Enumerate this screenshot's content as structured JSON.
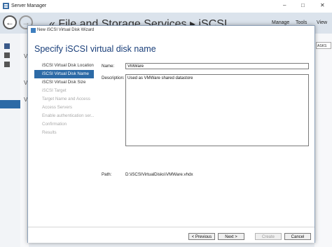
{
  "server_manager": {
    "title": "Server Manager",
    "breadcrumb": "« File and Storage Services ▸ iSCSI",
    "menu": [
      "Manage",
      "Tools",
      "View"
    ],
    "tasks_label": "ASKS",
    "minimize": "–",
    "maximize": "□",
    "close": "✕",
    "back": "←",
    "forward": "→",
    "left_letters": [
      "V",
      "V",
      "V"
    ]
  },
  "wizard": {
    "title": "New iSCSI Virtual Disk Wizard",
    "heading": "Specify iSCSI virtual disk name",
    "steps": [
      {
        "label": "iSCSI Virtual Disk Location",
        "state": "done"
      },
      {
        "label": "iSCSI Virtual Disk Name",
        "state": "active"
      },
      {
        "label": "iSCSI Virtual Disk Size",
        "state": "enabled"
      },
      {
        "label": "iSCSI Target",
        "state": "disabled"
      },
      {
        "label": "Target Name and Access",
        "state": "disabled"
      },
      {
        "label": "Access Servers",
        "state": "disabled"
      },
      {
        "label": "Enable authentication ser...",
        "state": "disabled"
      },
      {
        "label": "Confirmation",
        "state": "disabled"
      },
      {
        "label": "Results",
        "state": "disabled"
      }
    ],
    "form": {
      "name_label": "Name:",
      "name_value": "VMWare",
      "description_label": "Description:",
      "description_value": "Used as VMWare shared datastore",
      "path_label": "Path:",
      "path_value": "D:\\iSCSIVirtualDisks\\VMWare.vhdx"
    },
    "buttons": {
      "previous": "< Previous",
      "next": "Next >",
      "create": "Create",
      "cancel": "Cancel"
    }
  }
}
